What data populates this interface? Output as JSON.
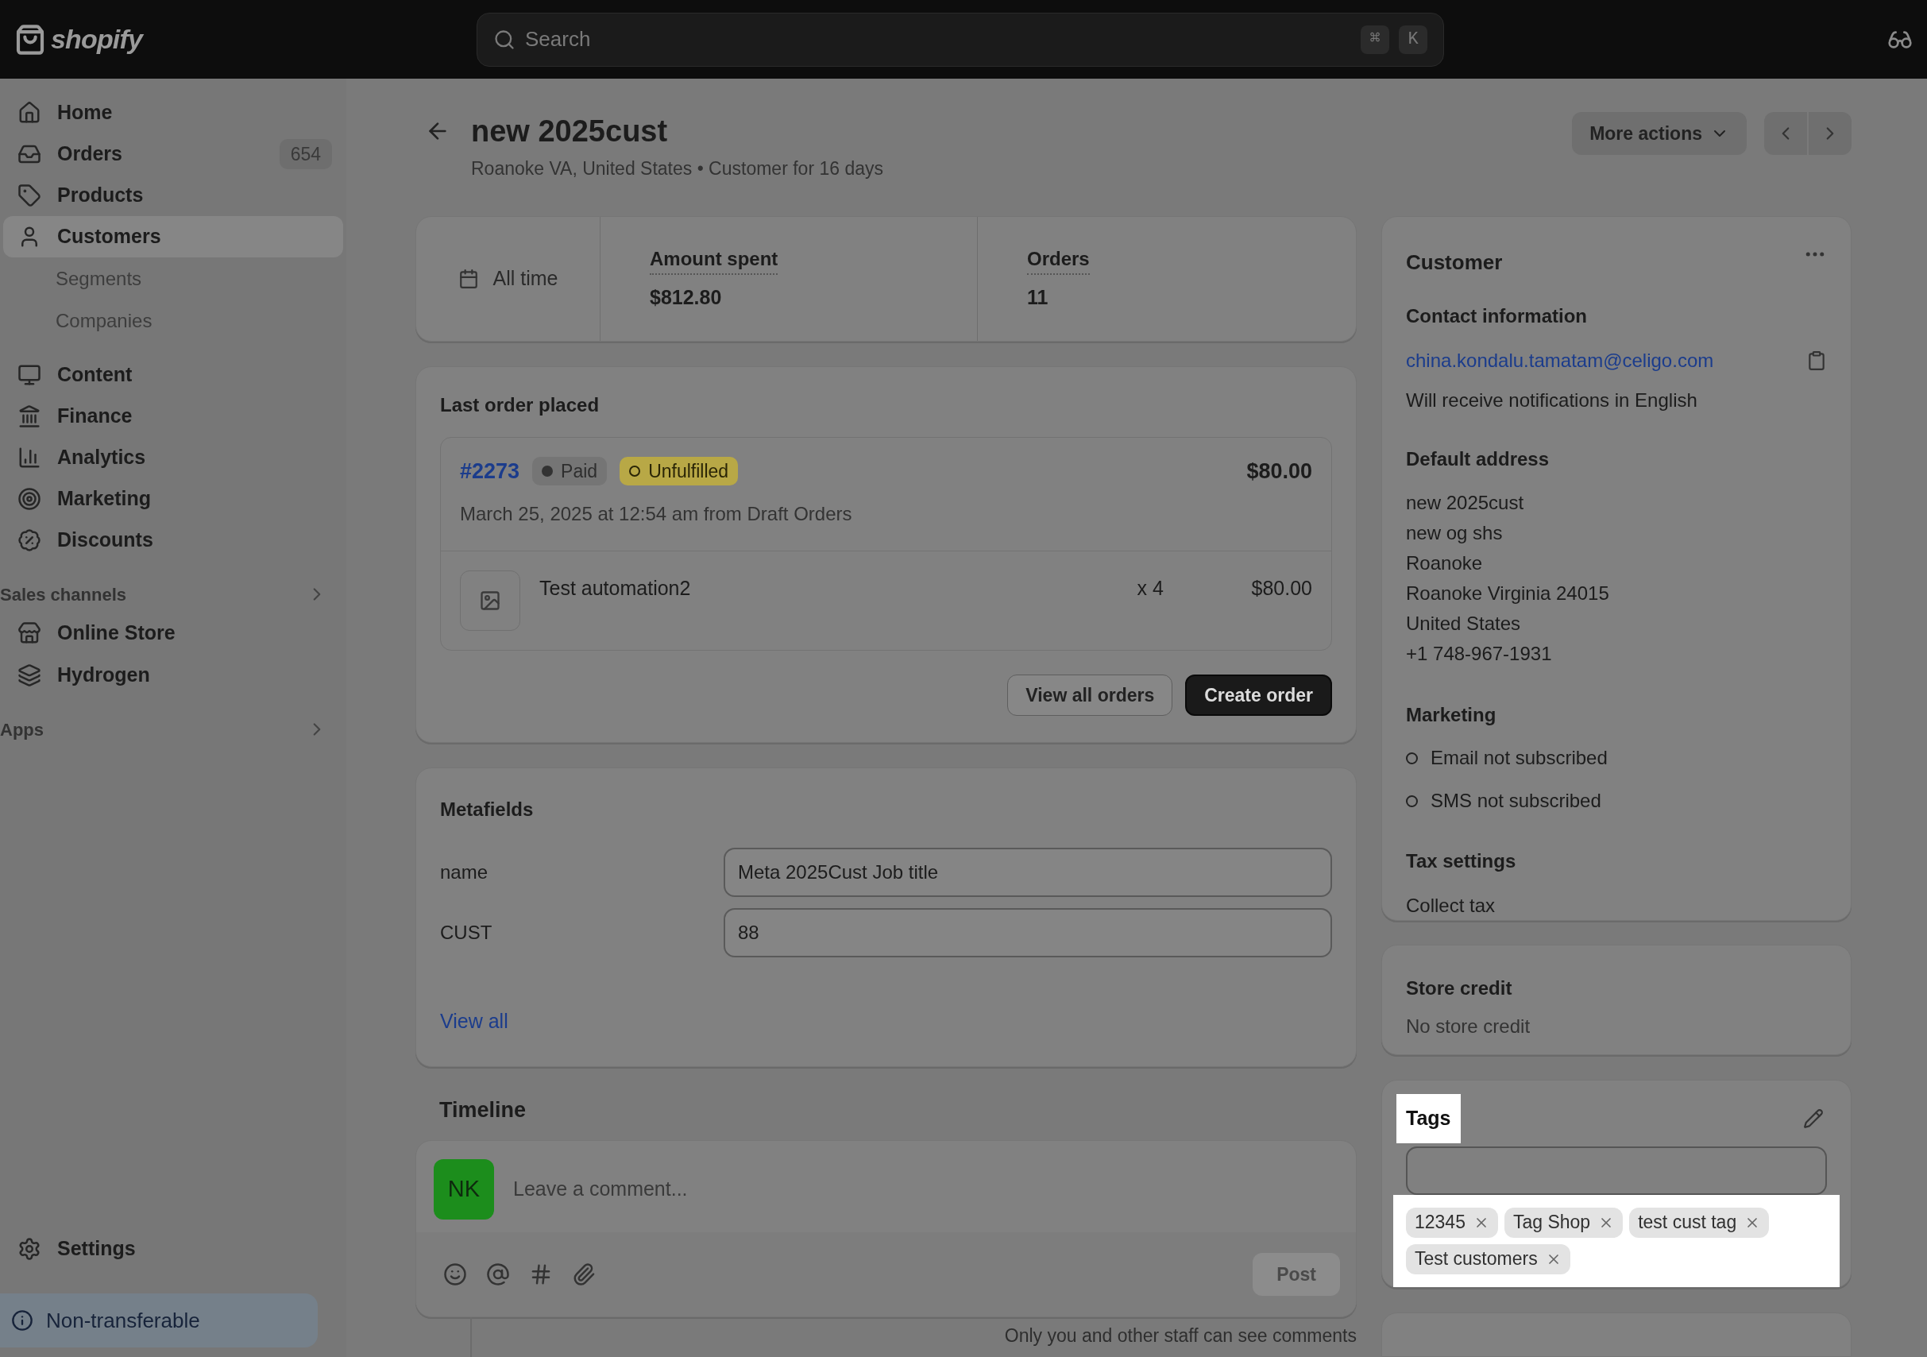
{
  "top_bar": {
    "logo": "shopify",
    "search": {
      "placeholder": "Search",
      "shortcut_keys": [
        "⌘",
        "K"
      ]
    }
  },
  "sidebar": {
    "items": [
      {
        "label": "Home",
        "selected": false
      },
      {
        "label": "Orders",
        "badge": "654",
        "selected": false
      },
      {
        "label": "Products",
        "selected": false
      },
      {
        "label": "Customers",
        "selected": true,
        "children": [
          {
            "label": "Segments",
            "selected": false
          },
          {
            "label": "Companies",
            "selected": false
          }
        ]
      },
      {
        "label": "Content",
        "selected": false
      },
      {
        "label": "Finance",
        "selected": false
      },
      {
        "label": "Analytics",
        "selected": false
      },
      {
        "label": "Marketing",
        "selected": false
      },
      {
        "label": "Discounts",
        "selected": false
      }
    ],
    "sections": [
      {
        "title": "Sales channels",
        "items": [
          {
            "label": "Online Store",
            "selected": false
          },
          {
            "label": "Hydrogen",
            "selected": false
          }
        ]
      },
      {
        "title": "Apps"
      }
    ],
    "settings": "Settings",
    "notice": "Non-transferable"
  },
  "header": {
    "title": "new 2025cust",
    "subtitle": "Roanoke VA, United States • Customer for 16 days",
    "more_actions": "More actions"
  },
  "stats": {
    "period": "All time",
    "metrics": [
      {
        "label": "Amount spent",
        "value": "$812.80"
      },
      {
        "label": "Orders",
        "value": "11"
      }
    ]
  },
  "last_order": {
    "heading": "Last order placed",
    "order_number": "#2273",
    "badges": [
      {
        "label": "Paid",
        "kind": "paid"
      },
      {
        "label": "Unfulfilled",
        "kind": "unfulfilled"
      }
    ],
    "total": "$80.00",
    "date": "March 25, 2025 at 12:54 am from Draft Orders",
    "line_items": [
      {
        "name": "Test automation2",
        "quantity": "x 4",
        "price": "$80.00"
      }
    ],
    "buttons": [
      {
        "label": "View all orders",
        "kind": "secondary"
      },
      {
        "label": "Create order",
        "kind": "primary"
      }
    ]
  },
  "metafields": {
    "heading": "Metafields",
    "fields": [
      {
        "label": "name",
        "value": "Meta 2025Cust Job title"
      },
      {
        "label": "CUST",
        "value": "88"
      }
    ],
    "link": "View all"
  },
  "timeline": {
    "heading": "Timeline",
    "avatar": "NK",
    "comment_placeholder": "Leave a comment...",
    "post_button": {
      "label": "Post",
      "disabled": true
    },
    "note": "Only you and other staff can see comments"
  },
  "customer": {
    "heading": "Customer",
    "contact_heading": "Contact information",
    "email": "china.kondalu.tamatam@celigo.com",
    "language_note": "Will receive notifications in English",
    "address_heading": "Default address",
    "address_lines": [
      "new 2025cust",
      "new og shs",
      "Roanoke",
      "Roanoke Virginia 24015",
      "United States",
      "+1 748-967-1931"
    ],
    "marketing_heading": "Marketing",
    "marketing": [
      {
        "label": "Email not subscribed",
        "subscribed": false
      },
      {
        "label": "SMS not subscribed",
        "subscribed": false
      }
    ],
    "tax_heading": "Tax settings",
    "tax_value": "Collect tax"
  },
  "store_credit": {
    "heading": "Store credit",
    "value": "No store credit"
  },
  "tags": {
    "heading": "Tags",
    "highlighted": true,
    "items": [
      "12345",
      "Tag Shop",
      "test cust tag",
      "Test customers"
    ]
  }
}
